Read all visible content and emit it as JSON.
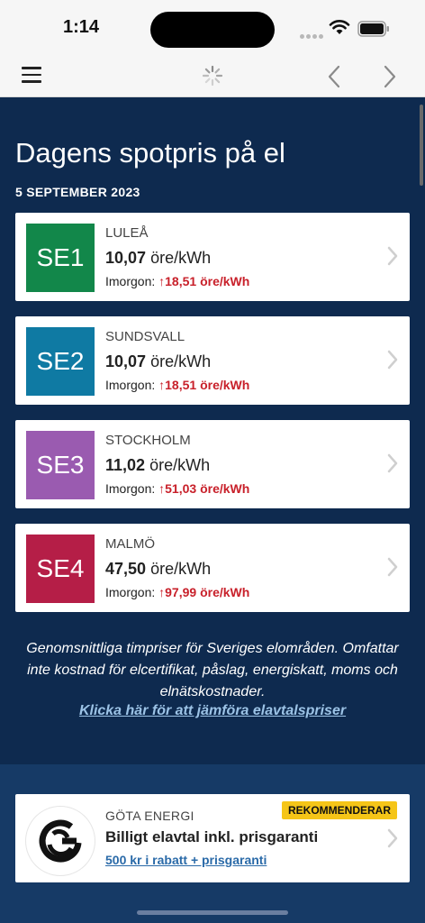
{
  "status_bar": {
    "time": "1:14"
  },
  "page": {
    "title": "Dagens spotpris på el",
    "date": "5 SEPTEMBER 2023"
  },
  "regions": [
    {
      "code": "SE1",
      "city": "LULEÅ",
      "price_value": "10,07",
      "price_unit": "öre/kWh",
      "tomorrow_label": "Imorgon:",
      "tomorrow_arrow": "↑",
      "tomorrow_price": "18,51 öre/kWh",
      "color": "#12874a"
    },
    {
      "code": "SE2",
      "city": "SUNDSVALL",
      "price_value": "10,07",
      "price_unit": "öre/kWh",
      "tomorrow_label": "Imorgon:",
      "tomorrow_arrow": "↑",
      "tomorrow_price": "18,51 öre/kWh",
      "color": "#0f7aa3"
    },
    {
      "code": "SE3",
      "city": "STOCKHOLM",
      "price_value": "11,02",
      "price_unit": "öre/kWh",
      "tomorrow_label": "Imorgon:",
      "tomorrow_arrow": "↑",
      "tomorrow_price": "51,03 öre/kWh",
      "color": "#9a5bb0"
    },
    {
      "code": "SE4",
      "city": "MALMÖ",
      "price_value": "47,50",
      "price_unit": "öre/kWh",
      "tomorrow_label": "Imorgon:",
      "tomorrow_arrow": "↑",
      "tomorrow_price": "97,99 öre/kWh",
      "color": "#b51e47"
    }
  ],
  "note": {
    "text": "Genomsnittliga timpriser för Sveriges elområden. Omfattar inte kostnad för elcertifikat, påslag, energiskatt, moms och elnätskostnader.",
    "link": "Klicka här för att jämföra elavtalspriser"
  },
  "promo": {
    "brand": "GÖTA ENERGI",
    "badge": "REKOMMENDERAR",
    "headline": "Billigt elavtal inkl. prisgaranti",
    "offer": "500 kr i rabatt + prisgaranti"
  },
  "colors": {
    "background": "#0e2a4f",
    "lower_background": "#163a66",
    "price_up": "#c8202a",
    "badge": "#f5c518",
    "link": "#9cc3e6"
  }
}
